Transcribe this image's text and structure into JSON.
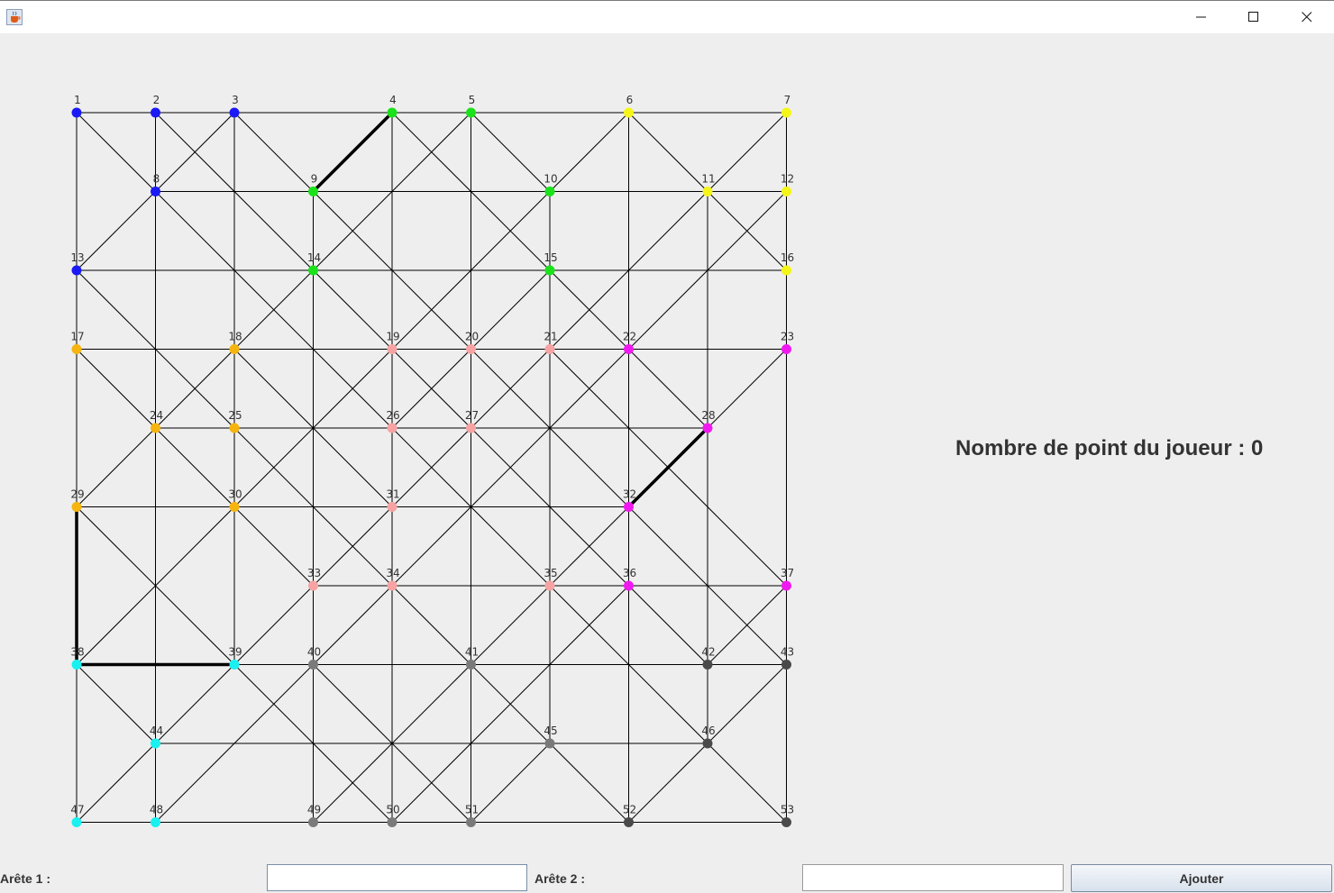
{
  "window": {
    "app_icon": "java-coffee-cup-icon",
    "controls": [
      "minimize-icon",
      "maximize-icon",
      "close-icon"
    ]
  },
  "score": {
    "label": "Nombre de point du joueur : 0"
  },
  "form": {
    "arete1_label": "Arête 1 :",
    "arete1_value": "",
    "arete2_label": "Arête 2 :",
    "arete2_value": "",
    "add_button": "Ajouter"
  },
  "colors": {
    "blue": "#1a1af5",
    "green": "#1be21b",
    "yellow": "#f5f51a",
    "orange": "#f5b40f",
    "pink": "#f7a3a3",
    "magenta": "#f01af0",
    "cyan": "#1af0f0",
    "gray": "#7a7a7a",
    "darkgray": "#4a4a4a"
  },
  "graph": {
    "grid": {
      "cols": 10,
      "rows": 10
    },
    "nodes": [
      {
        "id": "1",
        "c": 0,
        "r": 0,
        "color": "blue"
      },
      {
        "id": "2",
        "c": 1,
        "r": 0,
        "color": "blue"
      },
      {
        "id": "3",
        "c": 2,
        "r": 0,
        "color": "blue"
      },
      {
        "id": "4",
        "c": 4,
        "r": 0,
        "color": "green"
      },
      {
        "id": "5",
        "c": 5,
        "r": 0,
        "color": "green"
      },
      {
        "id": "6",
        "c": 7,
        "r": 0,
        "color": "yellow"
      },
      {
        "id": "7",
        "c": 9,
        "r": 0,
        "color": "yellow"
      },
      {
        "id": "8",
        "c": 1,
        "r": 1,
        "color": "blue"
      },
      {
        "id": "9",
        "c": 3,
        "r": 1,
        "color": "green"
      },
      {
        "id": "10",
        "c": 6,
        "r": 1,
        "color": "green"
      },
      {
        "id": "11",
        "c": 8,
        "r": 1,
        "color": "yellow"
      },
      {
        "id": "12",
        "c": 9,
        "r": 1,
        "color": "yellow"
      },
      {
        "id": "13",
        "c": 0,
        "r": 2,
        "color": "blue"
      },
      {
        "id": "14",
        "c": 3,
        "r": 2,
        "color": "green"
      },
      {
        "id": "15",
        "c": 6,
        "r": 2,
        "color": "green"
      },
      {
        "id": "16",
        "c": 9,
        "r": 2,
        "color": "yellow"
      },
      {
        "id": "17",
        "c": 0,
        "r": 3,
        "color": "orange"
      },
      {
        "id": "18",
        "c": 2,
        "r": 3,
        "color": "orange"
      },
      {
        "id": "19",
        "c": 4,
        "r": 3,
        "color": "pink"
      },
      {
        "id": "20",
        "c": 5,
        "r": 3,
        "color": "pink"
      },
      {
        "id": "21",
        "c": 6,
        "r": 3,
        "color": "pink"
      },
      {
        "id": "22",
        "c": 7,
        "r": 3,
        "color": "magenta"
      },
      {
        "id": "23",
        "c": 9,
        "r": 3,
        "color": "magenta"
      },
      {
        "id": "24",
        "c": 1,
        "r": 4,
        "color": "orange"
      },
      {
        "id": "25",
        "c": 2,
        "r": 4,
        "color": "orange"
      },
      {
        "id": "26",
        "c": 4,
        "r": 4,
        "color": "pink"
      },
      {
        "id": "27",
        "c": 5,
        "r": 4,
        "color": "pink"
      },
      {
        "id": "28",
        "c": 8,
        "r": 4,
        "color": "magenta"
      },
      {
        "id": "29",
        "c": 0,
        "r": 5,
        "color": "orange"
      },
      {
        "id": "30",
        "c": 2,
        "r": 5,
        "color": "orange"
      },
      {
        "id": "31",
        "c": 4,
        "r": 5,
        "color": "pink"
      },
      {
        "id": "32",
        "c": 7,
        "r": 5,
        "color": "magenta"
      },
      {
        "id": "33",
        "c": 3,
        "r": 6,
        "color": "pink"
      },
      {
        "id": "34",
        "c": 4,
        "r": 6,
        "color": "pink"
      },
      {
        "id": "35",
        "c": 6,
        "r": 6,
        "color": "pink"
      },
      {
        "id": "36",
        "c": 7,
        "r": 6,
        "color": "magenta"
      },
      {
        "id": "37",
        "c": 9,
        "r": 6,
        "color": "magenta"
      },
      {
        "id": "38",
        "c": 0,
        "r": 7,
        "color": "cyan"
      },
      {
        "id": "39",
        "c": 2,
        "r": 7,
        "color": "cyan"
      },
      {
        "id": "40",
        "c": 3,
        "r": 7,
        "color": "gray"
      },
      {
        "id": "41",
        "c": 5,
        "r": 7,
        "color": "gray"
      },
      {
        "id": "42",
        "c": 8,
        "r": 7,
        "color": "darkgray"
      },
      {
        "id": "43",
        "c": 9,
        "r": 7,
        "color": "darkgray"
      },
      {
        "id": "44",
        "c": 1,
        "r": 8,
        "color": "cyan"
      },
      {
        "id": "45",
        "c": 6,
        "r": 8,
        "color": "gray"
      },
      {
        "id": "46",
        "c": 8,
        "r": 8,
        "color": "darkgray"
      },
      {
        "id": "47",
        "c": 0,
        "r": 9,
        "color": "cyan"
      },
      {
        "id": "48",
        "c": 1,
        "r": 9,
        "color": "cyan"
      },
      {
        "id": "49",
        "c": 3,
        "r": 9,
        "color": "gray"
      },
      {
        "id": "50",
        "c": 4,
        "r": 9,
        "color": "gray"
      },
      {
        "id": "51",
        "c": 5,
        "r": 9,
        "color": "gray"
      },
      {
        "id": "52",
        "c": 7,
        "r": 9,
        "color": "darkgray"
      },
      {
        "id": "53",
        "c": 9,
        "r": 9,
        "color": "darkgray"
      }
    ],
    "selected_edges": [
      [
        "4",
        "9"
      ],
      [
        "28",
        "32"
      ],
      [
        "29",
        "38"
      ],
      [
        "38",
        "39"
      ]
    ]
  }
}
